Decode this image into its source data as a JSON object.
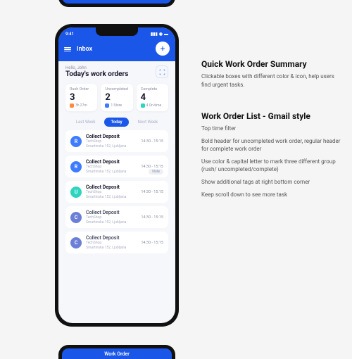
{
  "peek_bottom_title": "Work Order",
  "statusbar": {
    "time": "9:41"
  },
  "appbar": {
    "title": "Inbox"
  },
  "hero": {
    "greeting": "Hello, John",
    "headline": "Today's work orders"
  },
  "cards": [
    {
      "label": "Rush Order",
      "value": "3",
      "footer": "3h 27m",
      "dot": "orange"
    },
    {
      "label": "Uncompleted",
      "value": "2",
      "footer": "1 Store",
      "dot": "blue"
    },
    {
      "label": "Complete",
      "value": "4",
      "footer": "4 On-time",
      "dot": "teal"
    }
  ],
  "tabs": [
    {
      "label": "Last Week",
      "active": false
    },
    {
      "label": "Today",
      "active": true
    },
    {
      "label": "Next Week",
      "active": false
    }
  ],
  "rows": [
    {
      "letter": "R",
      "cls": "av-R",
      "title": "Collect Deposit",
      "titleCls": "uncomp",
      "shop": "TechShop",
      "addr": "Smartinska 152, Ljubljana",
      "time": "14:30 - 15:15",
      "tag": null
    },
    {
      "letter": "R",
      "cls": "av-R",
      "title": "Collect Deposit",
      "titleCls": "uncomp",
      "shop": "TechShop",
      "addr": "Smartinska 152, Ljubljana",
      "time": "14:30 - 15:15",
      "tag": "Note"
    },
    {
      "letter": "U",
      "cls": "av-U",
      "title": "Collect Deposit",
      "titleCls": "uncomp",
      "shop": "TechShop",
      "addr": "Smartinska 152, Ljubljana",
      "time": "14:30 - 15:15",
      "tag": null
    },
    {
      "letter": "C",
      "cls": "av-C",
      "title": "Collect Deposit",
      "titleCls": "comp",
      "shop": "TechShop",
      "addr": "Smartinska 152, Ljubljana",
      "time": "14:30 - 15:15",
      "tag": null
    },
    {
      "letter": "C",
      "cls": "av-C",
      "title": "Collect Deposit",
      "titleCls": "comp",
      "shop": "TechShop",
      "addr": "Smartinska 152, Ljubljana",
      "time": "14:30 - 15:15",
      "tag": null
    }
  ],
  "annot1": {
    "title": "Quick Work Order Summary",
    "body": "Clickable boxes with different color & icon, help users find urgent tasks."
  },
  "annot2": {
    "title": "Work Order List - Gmail style",
    "p1": "Top time filter",
    "p2": "Bold header for uncompleted work order, regular header for complete work order",
    "p3": "Use color & capital letter to mark three different group (rush/ uncompleted/complete)",
    "p4": "Show additional tags at right bottom corner",
    "p5": "Keep scroll down to see more task"
  }
}
